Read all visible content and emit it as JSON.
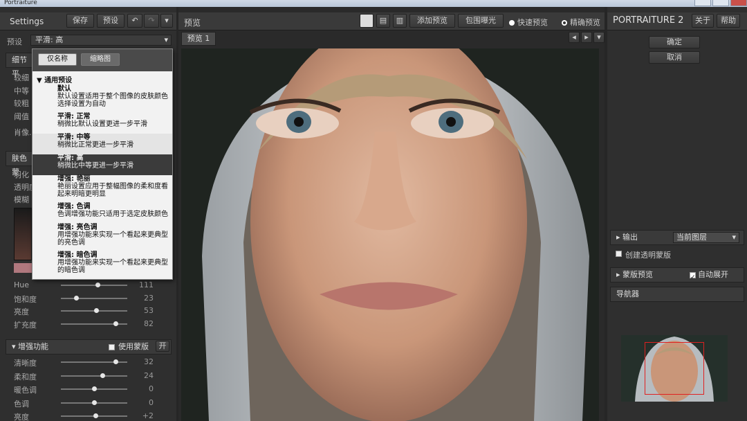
{
  "window": {
    "title": "Portraiture"
  },
  "left": {
    "header": {
      "title": "Settings",
      "save": "保存",
      "preset": "预设"
    },
    "preset_label": "预设",
    "preset_value": "平滑: 高",
    "detail_section": "细节平",
    "detail_rows": [
      "较细",
      "中等",
      "较粗",
      "阈值",
      "肖像..."
    ],
    "skin_section": "肤色蒙",
    "skin_rows": [
      "羽化",
      "透明度",
      "模糊"
    ],
    "color_sliders": [
      {
        "label": "Hue",
        "value": "111",
        "pos": 0.55
      },
      {
        "label": "饱和度",
        "value": "23",
        "pos": 0.23
      },
      {
        "label": "亮度",
        "value": "53",
        "pos": 0.53
      },
      {
        "label": "扩充度",
        "value": "82",
        "pos": 0.82
      }
    ],
    "enhance": {
      "title": "增强功能",
      "use_mask": "使用蒙版",
      "toggle": "开"
    },
    "enhance_sliders": [
      {
        "label": "清晰度",
        "value": "32",
        "pos": 0.82
      },
      {
        "label": "柔和度",
        "value": "24",
        "pos": 0.62
      },
      {
        "label": "暖色调",
        "value": "0",
        "pos": 0.5
      },
      {
        "label": "色调",
        "value": "0",
        "pos": 0.5
      },
      {
        "label": "亮度",
        "value": "+2",
        "pos": 0.52
      }
    ]
  },
  "menu": {
    "tab_name": "仅名称",
    "tab_thumb": "缩略图",
    "group": "通用预设",
    "items": [
      {
        "title": "默认",
        "desc": "默认设置适用于整个图像的皮肤颜色选择设置为自动"
      },
      {
        "title": "平滑: 正常",
        "desc": "稍微比默认设置更进一步平滑"
      },
      {
        "title": "平滑: 中等",
        "desc": "稍微比正常更进一步平滑"
      },
      {
        "title": "平滑: 高",
        "desc": "稍微比中等更进一步平滑"
      },
      {
        "title": "增强: 艳丽",
        "desc": "艳丽设置应用于整幅图像的柔和度看起来明暗更明显"
      },
      {
        "title": "增强: 色调",
        "desc": "色调增强功能只适用于选定皮肤颜色"
      },
      {
        "title": "增强: 亮色调",
        "desc": "用增强功能来实现一个看起来更典型的亮色调"
      },
      {
        "title": "增强: 暗色调",
        "desc": "用增强功能来实现一个看起来更典型的暗色调"
      }
    ]
  },
  "center": {
    "title": "预览",
    "add_preview": "添加预览",
    "clip": "包围曝光",
    "fast": "快速预览",
    "accurate": "精确预览",
    "tab": "预览 1"
  },
  "right": {
    "logo": "PORTRAITURE 2",
    "about": "关于",
    "help": "帮助",
    "ok": "确定",
    "cancel": "取消",
    "output": "输出",
    "output_value": "当前图层",
    "transparent": "创建透明蒙版",
    "mask_preview": "蒙版预览",
    "auto_expand": "自动展开",
    "navigator": "导航器"
  },
  "colors": {
    "accent": "#c0392b",
    "selected": "#3b3b3b"
  }
}
